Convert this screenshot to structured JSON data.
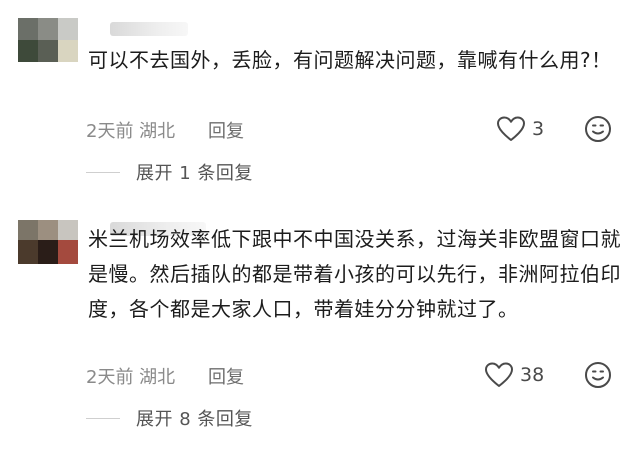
{
  "comments": [
    {
      "text": "可以不去国外，丢脸，有问题解决问题，靠喊有什么用?！",
      "time_location": "2天前 湖北",
      "reply_label": "回复",
      "like_count": "3",
      "expand_label": "展开 1 条回复"
    },
    {
      "text": "米兰机场效率低下跟中不中国没关系，过海关非欧盟窗口就是慢。然后插队的都是带着小孩的可以先行，非洲阿拉伯印度，各个都是大家人口，带着娃分分钟就过了。",
      "time_location": "2天前 湖北",
      "reply_label": "回复",
      "like_count": "38",
      "expand_label": "展开 8 条回复"
    }
  ],
  "icons": {
    "like": "heart-outline-icon",
    "emoji": "smiley-face-icon"
  },
  "colors": {
    "text_primary": "#1c1c1c",
    "text_secondary": "#8a8a8a",
    "icon": "#4a4a4a"
  }
}
